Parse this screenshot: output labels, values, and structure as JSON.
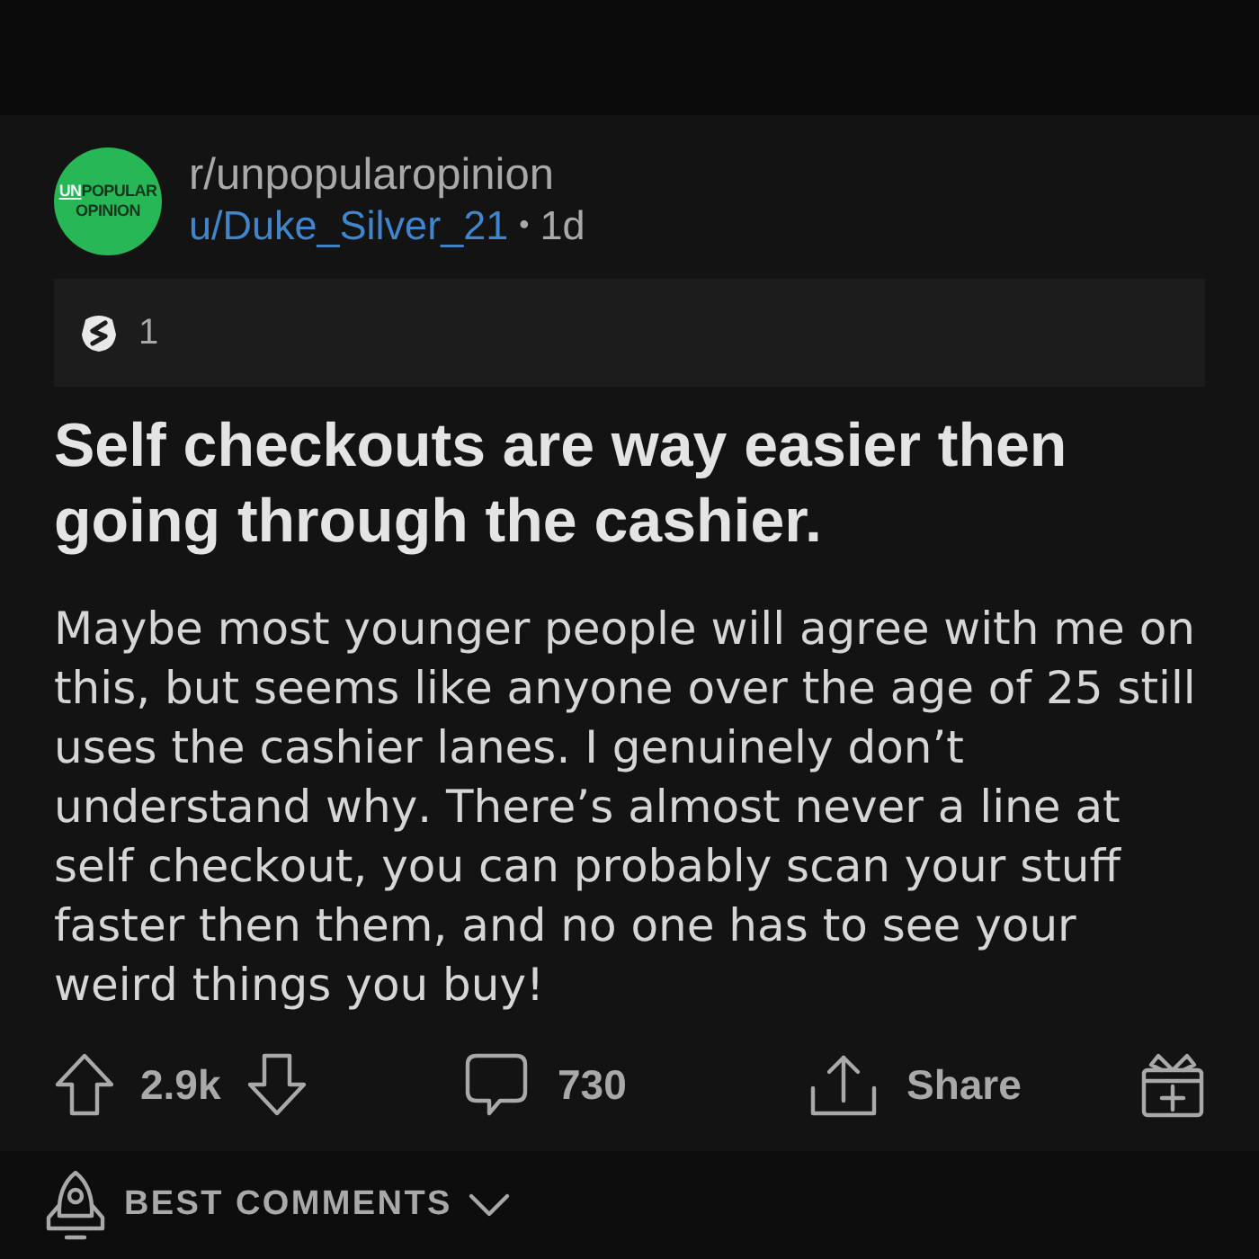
{
  "post": {
    "community": {
      "logo": {
        "accent": "UN",
        "line_1": "POPULAR",
        "line_2": "OPINION"
      },
      "name": "r/unpopularopinion"
    },
    "author": {
      "name": "u/Duke_Silver_21",
      "separator": "•",
      "age": "1d"
    },
    "awards": [
      {
        "count": "1"
      }
    ],
    "title": "Self checkouts are way easier then going through the cashier.",
    "body": "Maybe most younger people will agree with me on this, but seems like anyone over the age of 25 still uses the cashier lanes. I genuinely don’t understand why. There’s almost never a line at self checkout, you can probably scan your stuff faster then them, and no one has to see your weird things you buy!",
    "actions": [
      {
        "kind": "vote",
        "score": "2.9k"
      },
      {
        "kind": "comment",
        "count": "730"
      },
      {
        "kind": "share",
        "label": "Share"
      },
      {
        "kind": "gift"
      }
    ]
  },
  "comments_sort": {
    "label": "BEST COMMENTS"
  }
}
